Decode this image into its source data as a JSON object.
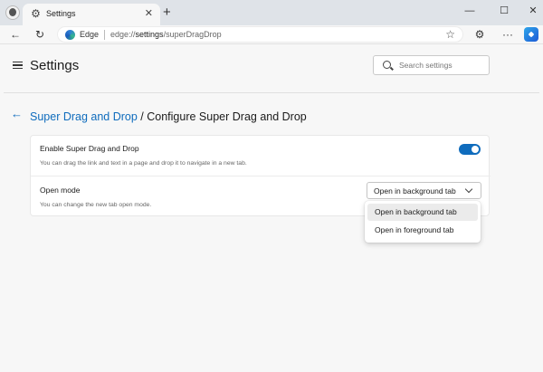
{
  "tab": {
    "title": "Settings",
    "icon": "gear-icon"
  },
  "toolbar": {
    "address_brand": "Edge",
    "address_url_prefix": "edge://",
    "address_url_bold": "settings",
    "address_url_suffix": "/superDragDrop"
  },
  "header": {
    "title": "Settings",
    "search_placeholder": "Search settings"
  },
  "breadcrumb": {
    "parent": "Super Drag and Drop",
    "separator": " / ",
    "current": "Configure Super Drag and Drop"
  },
  "settings": [
    {
      "label": "Enable Super Drag and Drop",
      "description": "You can drag the link and text in a page and drop it to navigate in a new tab.",
      "toggle_on": true
    },
    {
      "label": "Open mode",
      "description": "You can change the new tab open mode.",
      "selected": "Open in background tab"
    }
  ],
  "dropdown": {
    "options": [
      "Open in background tab",
      "Open in foreground tab"
    ],
    "highlighted_index": 0
  },
  "colors": {
    "accent": "#0f6cbd",
    "page_bg": "#f7f7f7",
    "titlebar_bg": "#dfe3e8"
  }
}
